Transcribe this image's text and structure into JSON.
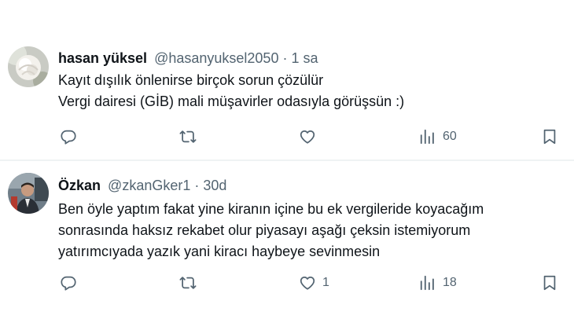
{
  "tweets": [
    {
      "display_name": "hasan yüksel",
      "handle": "@hasanyuksel2050",
      "separator": "·",
      "time": "1 sa",
      "lines": [
        "Kayıt dışılık önlenirse birçok sorun çözülür",
        "Vergi dairesi (GİB) mali müşavirler odasıyla görüşsün :)"
      ],
      "replies": "",
      "retweets": "",
      "likes": "",
      "views": "60"
    },
    {
      "display_name": "Özkan",
      "handle": "@zkanGker1",
      "separator": "·",
      "time": "30d",
      "lines": [
        "Ben öyle yaptım fakat yine kiranın içine bu ek vergileride koyacağım",
        "sonrasında haksız rekabet olur piyasayı aşağı çeksin istemiyorum",
        "yatırımcıyada yazık yani kiracı haybeye sevinmesin"
      ],
      "replies": "",
      "retweets": "",
      "likes": "1",
      "views": "18"
    }
  ],
  "icons": {
    "reply": "reply-icon",
    "retweet": "retweet-icon",
    "like": "heart-icon",
    "views": "views-icon",
    "bookmark": "bookmark-icon"
  },
  "colors": {
    "text": "#0f1419",
    "secondary": "#536471",
    "divider": "#eff3f4"
  }
}
